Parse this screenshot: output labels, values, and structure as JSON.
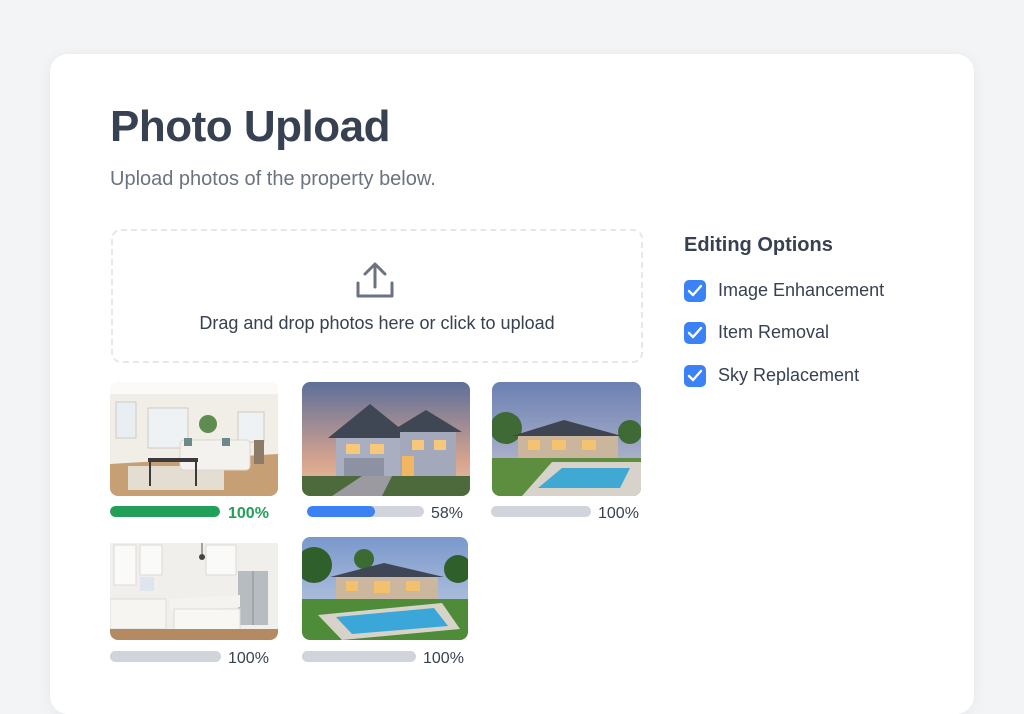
{
  "header": {
    "title": "Photo Upload",
    "subtitle": "Upload photos of the property below."
  },
  "dropzone": {
    "icon": "upload-icon",
    "text": "Drag and drop photos here or click to upload"
  },
  "colors": {
    "complete": "#22a05a",
    "in_progress": "#3b82f6",
    "idle_track": "#d1d5db",
    "checkbox": "#3b82f6"
  },
  "photos": [
    {
      "subject": "living room interior",
      "progress": 100,
      "progress_label": "100%",
      "status": "complete-highlight"
    },
    {
      "subject": "two-story house exterior at dusk",
      "progress": 58,
      "progress_label": "58%",
      "status": "uploading"
    },
    {
      "subject": "ranch house with pool",
      "progress": 100,
      "progress_label": "100%",
      "status": "complete"
    },
    {
      "subject": "white kitchen interior",
      "progress": 100,
      "progress_label": "100%",
      "status": "complete"
    },
    {
      "subject": "backyard with pool",
      "progress": 100,
      "progress_label": "100%",
      "status": "complete"
    }
  ],
  "editing_options": {
    "title": "Editing Options",
    "items": [
      {
        "label": "Image Enhancement",
        "checked": true
      },
      {
        "label": "Item Removal",
        "checked": true
      },
      {
        "label": "Sky Replacement",
        "checked": true
      }
    ]
  }
}
